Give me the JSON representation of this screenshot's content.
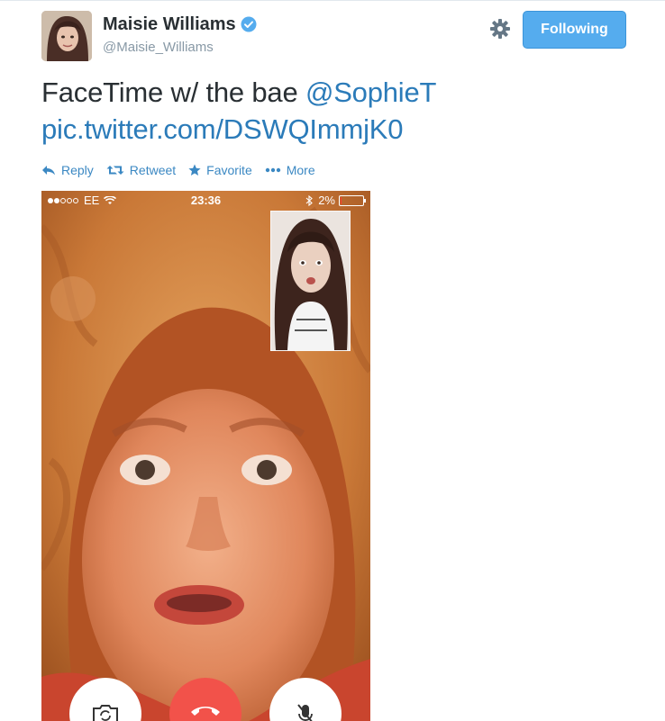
{
  "user": {
    "name": "Maisie Williams",
    "handle": "@Maisie_Williams",
    "verified": true
  },
  "header": {
    "follow_label": "Following",
    "settings_icon": "gear-icon"
  },
  "tweet": {
    "text": "FaceTime w/ the bae",
    "mention": "@SophieT",
    "link": "pic.twitter.com/DSWQImmjK0"
  },
  "actions": {
    "reply": "Reply",
    "retweet": "Retweet",
    "favorite": "Favorite",
    "more": "More"
  },
  "phone": {
    "carrier": "EE",
    "signal_bars_full": 2,
    "signal_bars_empty": 3,
    "time": "23:36",
    "battery_text": "2%",
    "battery_level": 0.02
  },
  "colors": {
    "link": "#2b7bb9",
    "action": "#3b88c3",
    "follow_button": "#55acee",
    "end_call": "#f2524a"
  }
}
